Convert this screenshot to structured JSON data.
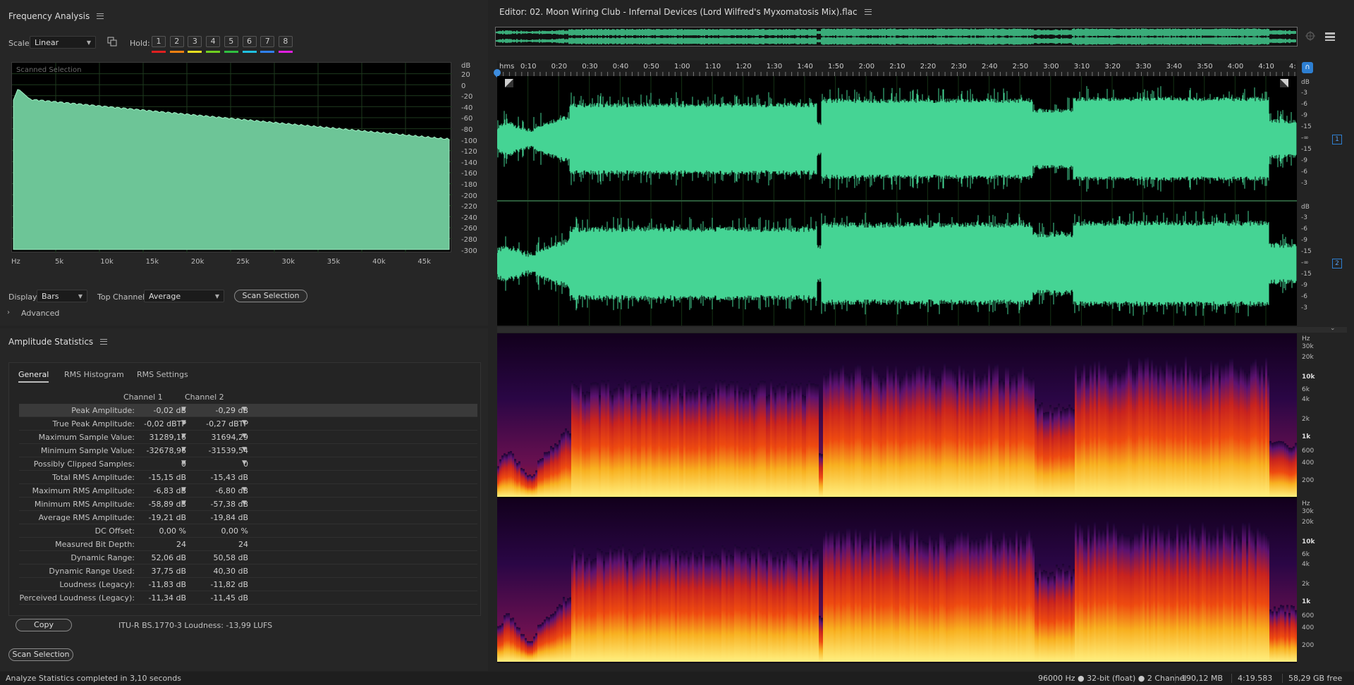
{
  "freq": {
    "title": "Frequency Analysis",
    "scale_label": "Scale:",
    "scale_value": "Linear",
    "hold_label": "Hold:",
    "holds": [
      "1",
      "2",
      "3",
      "4",
      "5",
      "6",
      "7",
      "8"
    ],
    "hold_colors": [
      "#e02020",
      "#f08010",
      "#e8e020",
      "#70d020",
      "#30c040",
      "#20c0e0",
      "#3080f0",
      "#e020e0"
    ],
    "overlay": "Scanned Selection",
    "db_unit": "dB",
    "db_ticks": [
      "20",
      "0",
      "-20",
      "-40",
      "-60",
      "-80",
      "-100",
      "-120",
      "-140",
      "-160",
      "-180",
      "-200",
      "-220",
      "-240",
      "-260",
      "-280",
      "-300"
    ],
    "hz_unit": "Hz",
    "hz_ticks": [
      "5k",
      "10k",
      "15k",
      "20k",
      "25k",
      "30k",
      "35k",
      "40k",
      "45k"
    ],
    "display_label": "Display:",
    "display_value": "Bars",
    "top_channel_label": "Top Channel:",
    "top_channel_value": "Average",
    "scan_button": "Scan Selection",
    "advanced": "Advanced"
  },
  "amp": {
    "title": "Amplitude Statistics",
    "tabs": [
      "General",
      "RMS Histogram",
      "RMS Settings"
    ],
    "col1": "Channel 1",
    "col2": "Channel 2",
    "rows": [
      {
        "label": "Peak Amplitude:",
        "c1": "-0,02 dB",
        "c2": "-0,29 dB",
        "marker": true
      },
      {
        "label": "True Peak Amplitude:",
        "c1": "-0,02 dBTP",
        "c2": "-0,27 dBTP",
        "marker": true
      },
      {
        "label": "Maximum Sample Value:",
        "c1": "31289,16",
        "c2": "31694,29",
        "marker": true
      },
      {
        "label": "Minimum Sample Value:",
        "c1": "-32678,96",
        "c2": "-31539,54",
        "marker": true
      },
      {
        "label": "Possibly Clipped Samples:",
        "c1": "0",
        "c2": "0",
        "marker": true
      },
      {
        "label": "Total RMS Amplitude:",
        "c1": "-15,15 dB",
        "c2": "-15,43 dB",
        "marker": false
      },
      {
        "label": "Maximum RMS Amplitude:",
        "c1": "-6,83 dB",
        "c2": "-6,80 dB",
        "marker": true
      },
      {
        "label": "Minimum RMS Amplitude:",
        "c1": "-58,89 dB",
        "c2": "-57,38 dB",
        "marker": true
      },
      {
        "label": "Average RMS Amplitude:",
        "c1": "-19,21 dB",
        "c2": "-19,84 dB",
        "marker": false
      },
      {
        "label": "DC Offset:",
        "c1": "0,00 %",
        "c2": "0,00 %",
        "marker": false
      },
      {
        "label": "Measured Bit Depth:",
        "c1": "24",
        "c2": "24",
        "marker": false
      },
      {
        "label": "Dynamic Range:",
        "c1": "52,06 dB",
        "c2": "50,58 dB",
        "marker": false
      },
      {
        "label": "Dynamic Range Used:",
        "c1": "37,75 dB",
        "c2": "40,30 dB",
        "marker": false
      },
      {
        "label": "Loudness (Legacy):",
        "c1": "-11,83 dB",
        "c2": "-11,82 dB",
        "marker": false
      },
      {
        "label": "Perceived Loudness (Legacy):",
        "c1": "-11,34 dB",
        "c2": "-11,45 dB",
        "marker": false
      }
    ],
    "copy_button": "Copy",
    "loudness": "ITU-R BS.1770-3 Loudness: -13,99 LUFS",
    "scan_button": "Scan Selection"
  },
  "editor": {
    "title": "Editor: 02. Moon Wiring Club - Infernal Devices (Lord Wilfred's Myxomatosis Mix).flac",
    "time_unit": "hms",
    "time_ticks": [
      "0:10",
      "0:20",
      "0:30",
      "0:40",
      "0:50",
      "1:00",
      "1:10",
      "1:20",
      "1:30",
      "1:40",
      "1:50",
      "2:00",
      "2:10",
      "2:20",
      "2:30",
      "2:40",
      "2:50",
      "3:00",
      "3:10",
      "3:20",
      "3:30",
      "3:40",
      "3:50",
      "4:00",
      "4:10",
      "4:"
    ],
    "db_unit": "dB",
    "db_ticks": [
      "-3",
      "-6",
      "-9",
      "-15",
      "-∞",
      "-15",
      "-9",
      "-6",
      "-3"
    ],
    "channels": [
      "1",
      "2"
    ],
    "hz_unit": "Hz",
    "hz_ticks": [
      "30k",
      "20k",
      "10k",
      "6k",
      "4k",
      "2k",
      "1k",
      "600",
      "400",
      "200"
    ],
    "waveform_color": "#45d494"
  },
  "status": {
    "left": "Analyze Statistics completed in 3,10 seconds",
    "format": "96000 Hz ● 32-bit (float) ● 2 Channel",
    "size": "190,12 MB",
    "duration": "4:19.583",
    "free": "58,29 GB free"
  }
}
